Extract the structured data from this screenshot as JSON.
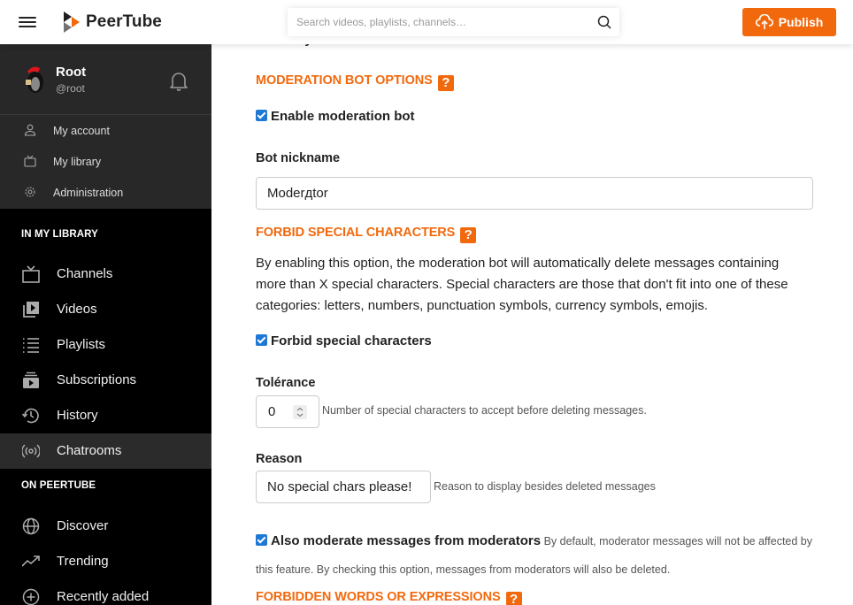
{
  "header": {
    "brand": "PeerTube",
    "search_placeholder": "Search videos, playlists, channels…",
    "publish_label": "Publish"
  },
  "user": {
    "name": "Root",
    "handle": "@root",
    "menu": [
      {
        "label": "My account",
        "icon": "user-icon"
      },
      {
        "label": "My library",
        "icon": "tv-icon"
      },
      {
        "label": "Administration",
        "icon": "cog-icon"
      }
    ]
  },
  "sidebar": {
    "library_title": "IN MY LIBRARY",
    "library_items": [
      {
        "label": "Channels",
        "icon": "channels-icon"
      },
      {
        "label": "Videos",
        "icon": "videos-icon"
      },
      {
        "label": "Playlists",
        "icon": "playlists-icon"
      },
      {
        "label": "Subscriptions",
        "icon": "subscriptions-icon"
      },
      {
        "label": "History",
        "icon": "history-icon"
      },
      {
        "label": "Chatrooms",
        "icon": "chatrooms-icon",
        "active": true
      }
    ],
    "peertube_title": "ON PEERTUBE",
    "peertube_items": [
      {
        "label": "Discover",
        "icon": "globe-icon"
      },
      {
        "label": "Trending",
        "icon": "trending-icon"
      },
      {
        "label": "Recently added",
        "icon": "plus-circle-icon"
      }
    ]
  },
  "main": {
    "anonymize_label": "Anonymize moderation actions",
    "anonymize_checked": true,
    "bot_section_title": "MODERATION BOT OPTIONS",
    "help_glyph": "?",
    "enable_bot_label": "Enable moderation bot",
    "enable_bot_checked": true,
    "bot_nickname_label": "Bot nickname",
    "bot_nickname_value": "Moderдtor",
    "special_section_title": "FORBID SPECIAL CHARACTERS",
    "special_description": "By enabling this option, the moderation bot will automatically delete messages containing more than X special characters. Special characters are those that don't fit into one of these categories: letters, numbers, punctuation symbols, currency symbols, emojis.",
    "forbid_special_label": "Forbid special characters",
    "forbid_special_checked": true,
    "tolerance_label": "Tolérance",
    "tolerance_value": "0",
    "tolerance_hint": "Number of special characters to accept before deleting messages.",
    "reason_label": "Reason",
    "reason_value": "No special chars please!",
    "reason_hint": "Reason to display besides deleted messages",
    "moderators_label": "Also moderate messages from moderators",
    "moderators_checked": true,
    "moderators_hint": "By default, moderator messages will not be affected by this feature. By checking this option, messages from moderators will also be deleted.",
    "forbidden_words_title": "FORBIDDEN WORDS OR EXPRESSIONS"
  },
  "colors": {
    "accent": "#f2690d",
    "checkbox": "#1e78d4",
    "sidebar_bg": "#000000",
    "user_block_bg": "#282828"
  }
}
